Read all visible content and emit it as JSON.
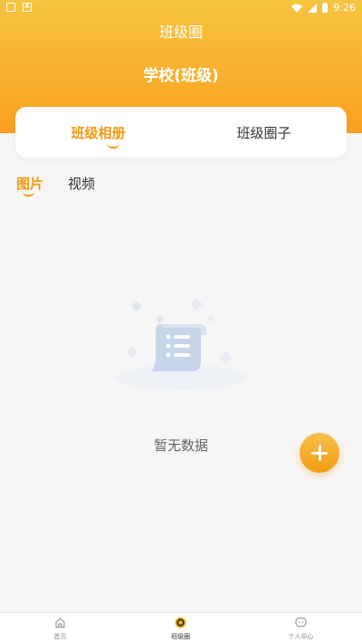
{
  "status_bar": {
    "time": "9:26"
  },
  "header": {
    "title": "班级圈",
    "school": "学校(班级)"
  },
  "tabs": [
    {
      "label": "班级相册"
    },
    {
      "label": "班级圈子"
    }
  ],
  "subtabs": [
    {
      "label": "图片"
    },
    {
      "label": "视频"
    }
  ],
  "empty": {
    "text": "暂无数据"
  },
  "bottom_nav": [
    {
      "label": "首页"
    },
    {
      "label": "班级圈"
    },
    {
      "label": "个人中心"
    }
  ],
  "colors": {
    "accent": "#f29c11",
    "header_top": "#f6c43f",
    "header_bottom": "#fb9f1f"
  },
  "icons": {
    "fab": "plus-icon",
    "home": "home-icon",
    "circle": "class-circle-icon",
    "me": "chat-bubble-icon"
  }
}
